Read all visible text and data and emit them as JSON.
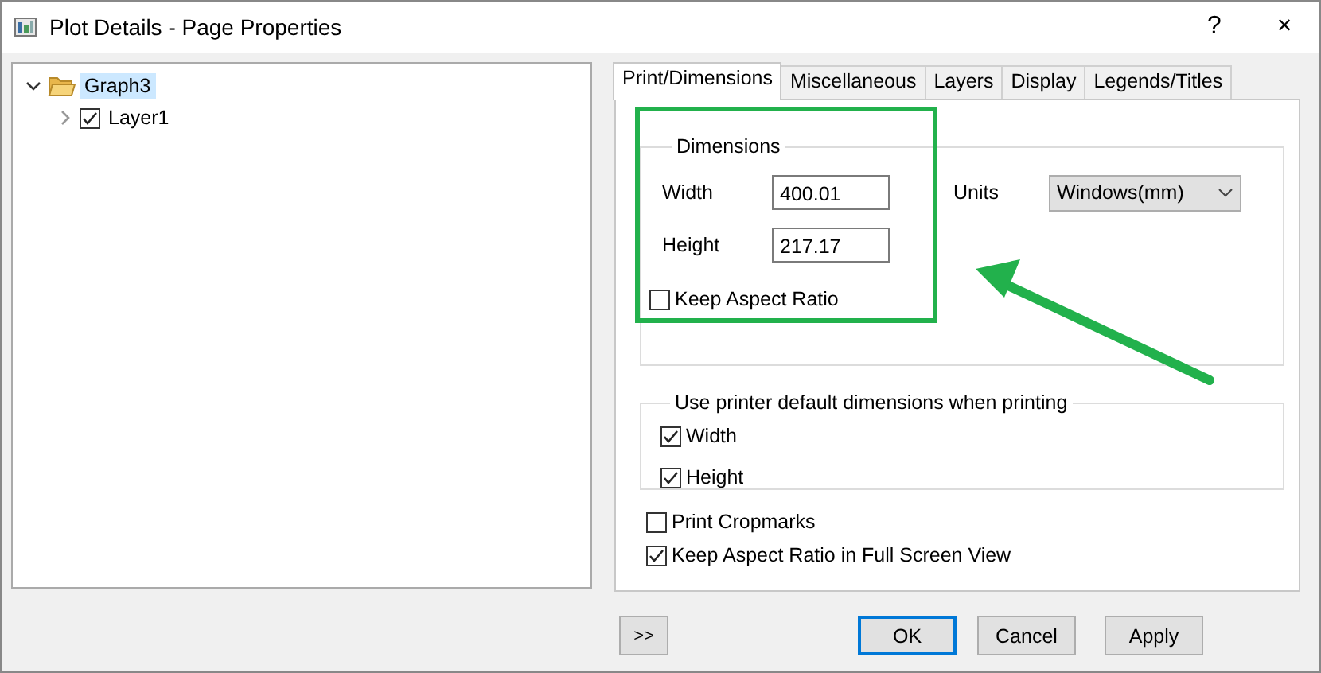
{
  "window": {
    "title": "Plot Details - Page Properties",
    "help": "?",
    "close": "×"
  },
  "tree": [
    {
      "label": "Graph3",
      "kind": "folder",
      "expanded": true,
      "selected": true,
      "children": [
        {
          "label": "Layer1",
          "kind": "checkbox",
          "checked": true,
          "expanded": false,
          "selected": false
        }
      ]
    }
  ],
  "tabs": [
    {
      "label": "Print/Dimensions",
      "selected": true
    },
    {
      "label": "Miscellaneous",
      "selected": false
    },
    {
      "label": "Layers",
      "selected": false
    },
    {
      "label": "Display",
      "selected": false
    },
    {
      "label": "Legends/Titles",
      "selected": false
    }
  ],
  "dimensions": {
    "title": "Dimensions",
    "width_label": "Width",
    "width_value": "400.01",
    "height_label": "Height",
    "height_value": "217.17",
    "units_label": "Units",
    "units_value": "Windows(mm)",
    "keep_aspect": {
      "label": "Keep Aspect Ratio",
      "checked": false
    }
  },
  "printer_defaults": {
    "title": "Use printer default dimensions when printing",
    "options": [
      {
        "label": "Width",
        "checked": true
      },
      {
        "label": "Height",
        "checked": true
      }
    ]
  },
  "options": [
    {
      "label": "Print Cropmarks",
      "checked": false
    },
    {
      "label": "Keep Aspect Ratio in Full Screen View",
      "checked": true
    }
  ],
  "buttons": [
    {
      "label": ">>",
      "default": false
    },
    {
      "label": "OK",
      "default": true
    },
    {
      "label": "Cancel",
      "default": false
    },
    {
      "label": "Apply",
      "default": false
    }
  ]
}
